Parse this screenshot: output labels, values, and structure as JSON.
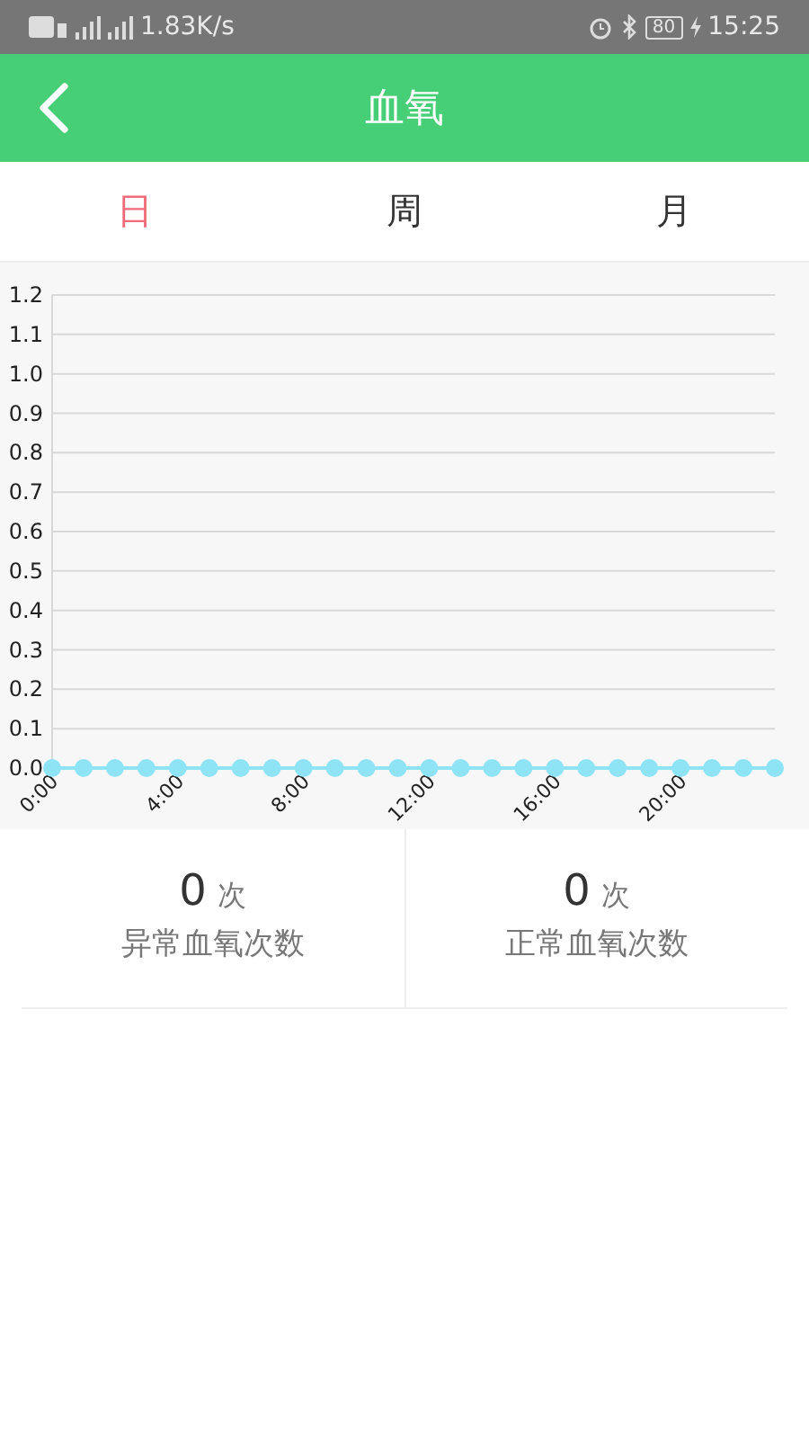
{
  "status_bar": {
    "speed": "1.83K/s",
    "battery": "80",
    "time": "15:25"
  },
  "header": {
    "title": "血氧"
  },
  "tabs": [
    {
      "label": "日",
      "selected": true
    },
    {
      "label": "周",
      "selected": false
    },
    {
      "label": "月",
      "selected": false
    }
  ],
  "chart_data": {
    "type": "line",
    "x": [
      0,
      1,
      2,
      3,
      4,
      5,
      6,
      7,
      8,
      9,
      10,
      11,
      12,
      13,
      14,
      15,
      16,
      17,
      18,
      19,
      20,
      21,
      22,
      23
    ],
    "series": [
      {
        "marker": "circle",
        "color": "#8ee3f5",
        "values": [
          0,
          0,
          0,
          0,
          0,
          0,
          0,
          0,
          0,
          0,
          0,
          0,
          0,
          0,
          0,
          0,
          0,
          0,
          0,
          0,
          0,
          0,
          0,
          0
        ]
      }
    ],
    "xlim": [
      0,
      23
    ],
    "ylim": [
      0,
      1.2
    ],
    "grid": true,
    "yticks": [
      {
        "value": 0,
        "label": "0.0"
      },
      {
        "value": 0.1,
        "label": "0.1"
      },
      {
        "value": 0.2,
        "label": "0.2"
      },
      {
        "value": 0.3,
        "label": "0.3"
      },
      {
        "value": 0.4,
        "label": "0.4"
      },
      {
        "value": 0.5,
        "label": "0.5"
      },
      {
        "value": 0.6,
        "label": "0.6"
      },
      {
        "value": 0.7,
        "label": "0.7"
      },
      {
        "value": 0.8,
        "label": "0.8"
      },
      {
        "value": 0.9,
        "label": "0.9"
      },
      {
        "value": 1.0,
        "label": "1.0"
      },
      {
        "value": 1.1,
        "label": "1.1"
      },
      {
        "value": 1.2,
        "label": "1.2"
      }
    ],
    "xticks": [
      {
        "value": 0,
        "label": "0:00"
      },
      {
        "value": 4,
        "label": "4:00"
      },
      {
        "value": 8,
        "label": "8:00"
      },
      {
        "value": 12,
        "label": "12:00"
      },
      {
        "value": 16,
        "label": "16:00"
      },
      {
        "value": 20,
        "label": "20:00"
      }
    ]
  },
  "stats": [
    {
      "count": "0",
      "unit": "次",
      "label": "异常血氧次数"
    },
    {
      "count": "0",
      "unit": "次",
      "label": "正常血氧次数"
    }
  ]
}
